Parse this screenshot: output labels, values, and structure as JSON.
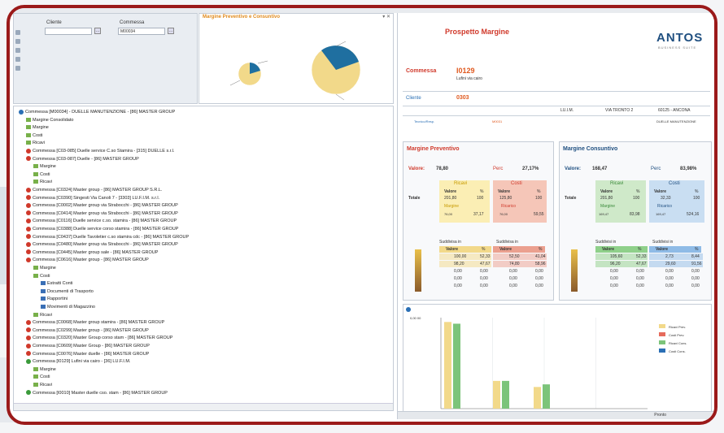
{
  "filters": {
    "cliente_label": "Cliente",
    "commessa_label": "Commessa",
    "commessa_value": "M00034"
  },
  "pie_panel": {
    "title": "Margine Preventivo e Consuntivo",
    "icons": "▾ ✕"
  },
  "tree": {
    "rows": [
      {
        "indent": 0,
        "icon": "blue",
        "text": "Commessa [M00034] - DUELLE MANUTENZIONE - [86] MASTER GROUP"
      },
      {
        "indent": 1,
        "icon": "folder",
        "text": "Margine Consolidato"
      },
      {
        "indent": 1,
        "icon": "folder",
        "text": "Margine"
      },
      {
        "indent": 1,
        "icon": "folder",
        "text": "Costi"
      },
      {
        "indent": 1,
        "icon": "folder",
        "text": "Ricavi"
      },
      {
        "indent": 1,
        "icon": "red",
        "text": "Commessa [C03-085] Duelle service C.so Stamira - [315] DUELLE s.r.l."
      },
      {
        "indent": 1,
        "icon": "red",
        "text": "Commessa [C03-087] Duelle - [86] MASTER GROUP"
      },
      {
        "indent": 2,
        "icon": "folder",
        "text": "Margine"
      },
      {
        "indent": 2,
        "icon": "folder",
        "text": "Costi"
      },
      {
        "indent": 2,
        "icon": "folder",
        "text": "Ricavi"
      },
      {
        "indent": 1,
        "icon": "red",
        "text": "Commessa [C0324] Master group - [86] MASTER GROUP S.R.L."
      },
      {
        "indent": 1,
        "icon": "red",
        "text": "Commessa [C0390] Singesti Via Canoli 7 - [3303] LU.F.I.M. s.r.l."
      },
      {
        "indent": 1,
        "icon": "red",
        "text": "Commessa [C0002] Master group via Strabocchi - [86] MASTER GROUP"
      },
      {
        "indent": 1,
        "icon": "red",
        "text": "Commessa [C0414] Master group via Strabocchi - [86] MASTER GROUP"
      },
      {
        "indent": 1,
        "icon": "red",
        "text": "Commessa [C0116] Duelle service c.so. stamira - [86] MASTER GROUP"
      },
      {
        "indent": 1,
        "icon": "red",
        "text": "Commessa [C0388] Duelle service corso stamira - [86] MASTER GROUP"
      },
      {
        "indent": 1,
        "icon": "red",
        "text": "Commessa [C0437] Duelle Tavoletier c.so stamira cdc - [86] MASTER GROUP"
      },
      {
        "indent": 1,
        "icon": "red",
        "text": "Commessa [C0480] Master group via Strabocchi - [86] MASTER GROUP"
      },
      {
        "indent": 1,
        "icon": "red",
        "text": "Commessa [C0445] Master group sale - [86] MASTER GROUP"
      },
      {
        "indent": 1,
        "icon": "red",
        "text": "Commessa [C0616] Master group - [86] MASTER GROUP"
      },
      {
        "indent": 2,
        "icon": "folder",
        "text": "Margine"
      },
      {
        "indent": 2,
        "icon": "folder",
        "text": "Costi"
      },
      {
        "indent": 3,
        "icon": "doc",
        "text": "Estratti Conti"
      },
      {
        "indent": 3,
        "icon": "doc",
        "text": "Documenti di Trasporto"
      },
      {
        "indent": 3,
        "icon": "doc",
        "text": "Rapportini"
      },
      {
        "indent": 3,
        "icon": "doc",
        "text": "Movimenti di Magazzino"
      },
      {
        "indent": 2,
        "icon": "folder",
        "text": "Ricavi"
      },
      {
        "indent": 1,
        "icon": "red",
        "text": "Commessa [C0068] Master group stamira - [86] MASTER GROUP"
      },
      {
        "indent": 1,
        "icon": "red",
        "text": "Commessa [C0299] Master group - [86] MASTER GROUP"
      },
      {
        "indent": 1,
        "icon": "red",
        "text": "Commessa [C0320] Master Group corso stam - [86] MASTER GROUP"
      },
      {
        "indent": 1,
        "icon": "red",
        "text": "Commessa [C0609] Master Group - [86] MASTER GROUP"
      },
      {
        "indent": 1,
        "icon": "red",
        "text": "Commessa [C0076] Master duelle - [86] MASTER GROUP"
      },
      {
        "indent": 1,
        "icon": "green",
        "text": "Commessa [I0129] Lufini via cairo - [36] LU.F.I.M."
      },
      {
        "indent": 2,
        "icon": "folder",
        "text": "Margine"
      },
      {
        "indent": 2,
        "icon": "folder",
        "text": "Costi"
      },
      {
        "indent": 2,
        "icon": "folder",
        "text": "Ricavi"
      },
      {
        "indent": 1,
        "icon": "green",
        "text": "Commessa [I0010] Master duelle cso. stam - [86] MASTER GROUP"
      }
    ]
  },
  "report": {
    "title": "Prospetto Margine",
    "logo": "ANTOS",
    "logo_sub": "BUSINESS SUITE",
    "commessa_label": "Commessa",
    "commessa_code": "I0129",
    "commessa_desc": "Lufini via cairo",
    "cliente_label": "Cliente",
    "cliente_code": "0303",
    "address_1": "LU.I.M.",
    "address_2": "VIA TRONTO 2",
    "address_3": "60125 - ANCONA",
    "tecnico_label": "Tecnico/Resp.",
    "tecnico_value": "M0031",
    "right_note": "DUELLE MANUTENZIONE"
  },
  "preventivo": {
    "title": "Margine Preventivo",
    "valore_label": "Valore:",
    "valore": "78,80",
    "perc_label": "Perc",
    "perc": "27,17%",
    "ricavi": "Ricavi",
    "costi": "Costi",
    "valore_col": "Valore",
    "pct_col": "%",
    "totale": "Totale",
    "ricavi_val": "201,80",
    "ricavi_pct": "100",
    "costi_val": "125,80",
    "costi_pct": "100",
    "margine_label": "Margine",
    "margine_val": "76,00",
    "margine_pct": "37,17",
    "ricarico_label": "Ricarico",
    "ricarico_val": "76,00",
    "ricarico_pct": "59,55",
    "sudd1": "Suddivisa in",
    "sudd2": "Suddivisa in",
    "rows_left": [
      [
        "100,00",
        "52,33"
      ],
      [
        "98,20",
        "47,67"
      ],
      [
        "0,00",
        "0,00"
      ],
      [
        "0,00",
        "0,00"
      ],
      [
        "0,00",
        "0,00"
      ]
    ],
    "rows_right": [
      [
        "52,50",
        "41,04"
      ],
      [
        "74,80",
        "58,96"
      ],
      [
        "0,00",
        "0,00"
      ],
      [
        "0,00",
        "0,00"
      ],
      [
        "0,00",
        "0,00"
      ]
    ]
  },
  "consuntivo": {
    "title": "Margine Consuntivo",
    "valore_label": "Valore:",
    "valore": "168,47",
    "perc_label": "Perc",
    "perc": "83,98%",
    "ricavi": "Ricavi",
    "costi": "Costi",
    "valore_col": "Valore",
    "pct_col": "%",
    "totale": "Totale",
    "ricavi_val": "201,80",
    "ricavi_pct": "100",
    "costi_val": "32,33",
    "costi_pct": "100",
    "margine_label": "Margine",
    "margine_val": "169,47",
    "margine_pct": "83,98",
    "ricarico_label": "Ricarico",
    "ricarico_val": "169,47",
    "ricarico_pct": "524,16",
    "sudd1": "Suddivisi in",
    "sudd2": "Suddivisi in",
    "rows_left": [
      [
        "105,60",
        "52,33"
      ],
      [
        "96,20",
        "47,67"
      ],
      [
        "0,00",
        "0,00"
      ],
      [
        "0,00",
        "0,00"
      ],
      [
        "0,00",
        "0,00"
      ]
    ],
    "rows_right": [
      [
        "2,73",
        "8,44"
      ],
      [
        "29,60",
        "91,56"
      ],
      [
        "0,00",
        "0,00"
      ],
      [
        "0,00",
        "0,00"
      ],
      [
        "0,00",
        "0,00"
      ]
    ]
  },
  "chart_data": {
    "type": "bar",
    "ylabel": "",
    "ytick_top": "0,00 00",
    "categories": [
      "",
      "",
      ""
    ],
    "series": [
      {
        "name": "Ricavi Prev.",
        "color": "#f2d98a",
        "values": [
          100,
          32,
          25
        ]
      },
      {
        "name": "Costi Prev.",
        "color": "#e66b5c",
        "values": [
          0,
          0,
          0
        ]
      },
      {
        "name": "Ricavi Cons.",
        "color": "#7cc47a",
        "values": [
          98,
          32,
          28
        ]
      },
      {
        "name": "Costi Cons.",
        "color": "#2a6fb5",
        "values": [
          0,
          0,
          0
        ]
      }
    ],
    "ylim": [
      0,
      105
    ]
  },
  "status": {
    "text": "Pronto"
  }
}
